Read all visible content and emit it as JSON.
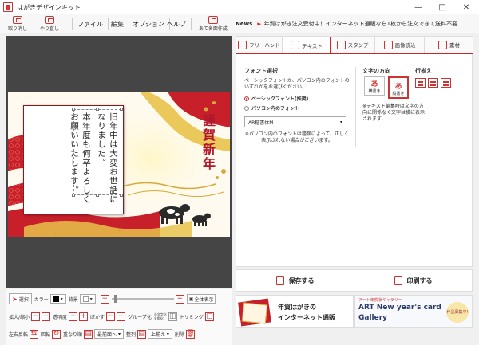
{
  "window": {
    "title": "はがきデザインキット"
  },
  "toolbar": {
    "undo": "取り消し",
    "redo": "やり直し",
    "menus": [
      "ファイル",
      "編集",
      "オプション",
      "ヘルプ"
    ],
    "address": "あて名面作成"
  },
  "news": {
    "label": "News",
    "text": "年賀はがき注文受付中！インターネット通販なら1枚から注文できて送料不要"
  },
  "card": {
    "message_lines": [
      "旧年中は大変お世話に",
      "なりました。",
      "本年度も何卒よろしく",
      "お願いいたします。"
    ],
    "greeting": "謹賀新年"
  },
  "bottom": {
    "select_label": "選択",
    "color_label": "カラー",
    "bg_label": "背景",
    "fullview": "全体表示",
    "zoom_label": "拡大/縮小",
    "transparency_label": "透明度",
    "blur_label": "ぼかす",
    "group_label": "グループ化",
    "group_sub": "小文字化\n全角化",
    "trim_label": "トリミング",
    "flip_label": "左右反転",
    "rotate_label": "回転",
    "order_label": "重なり順",
    "order_value": "最前面へ",
    "align_label": "整列",
    "align_value": "上揃え",
    "delete_label": "削除"
  },
  "tabs": [
    {
      "label": "フリーハンド"
    },
    {
      "label": "テキスト"
    },
    {
      "label": "スタンプ"
    },
    {
      "label": "画像読込"
    },
    {
      "label": "素材"
    }
  ],
  "font_panel": {
    "title": "フォント選択",
    "desc": "ベーシックフォントか、パソコン内のフォントのいずれかをお選びください。",
    "opt_basic": "ベーシックフォント(推奨)",
    "opt_pc": "パソコン内のフォント",
    "selected_font": "AR楷書体M",
    "note": "※パソコン内のフォントは種類によって、正しく表示されない場合がございます。"
  },
  "direction_panel": {
    "title": "文字の方向",
    "horizontal": "横書き",
    "vertical": "縦書き",
    "align_title": "行揃え",
    "note": "※テキスト編集時は文字の方向に関係なく文字は横に表示されます。"
  },
  "actions": {
    "save": "保存する",
    "print": "印刷する"
  },
  "banners": {
    "left_title": "年賀はがきの",
    "left_sub": "インターネット通販",
    "right_top": "アート年賀状ギャラリー",
    "right_main": "ART New year's card",
    "right_gallery": "Gallery",
    "right_badge": "作品募集中!"
  },
  "colors": {
    "accent": "#c9262c",
    "canvas_bg": "#454545",
    "wave_red": "#c8202b",
    "gold": "#d6a93a"
  }
}
